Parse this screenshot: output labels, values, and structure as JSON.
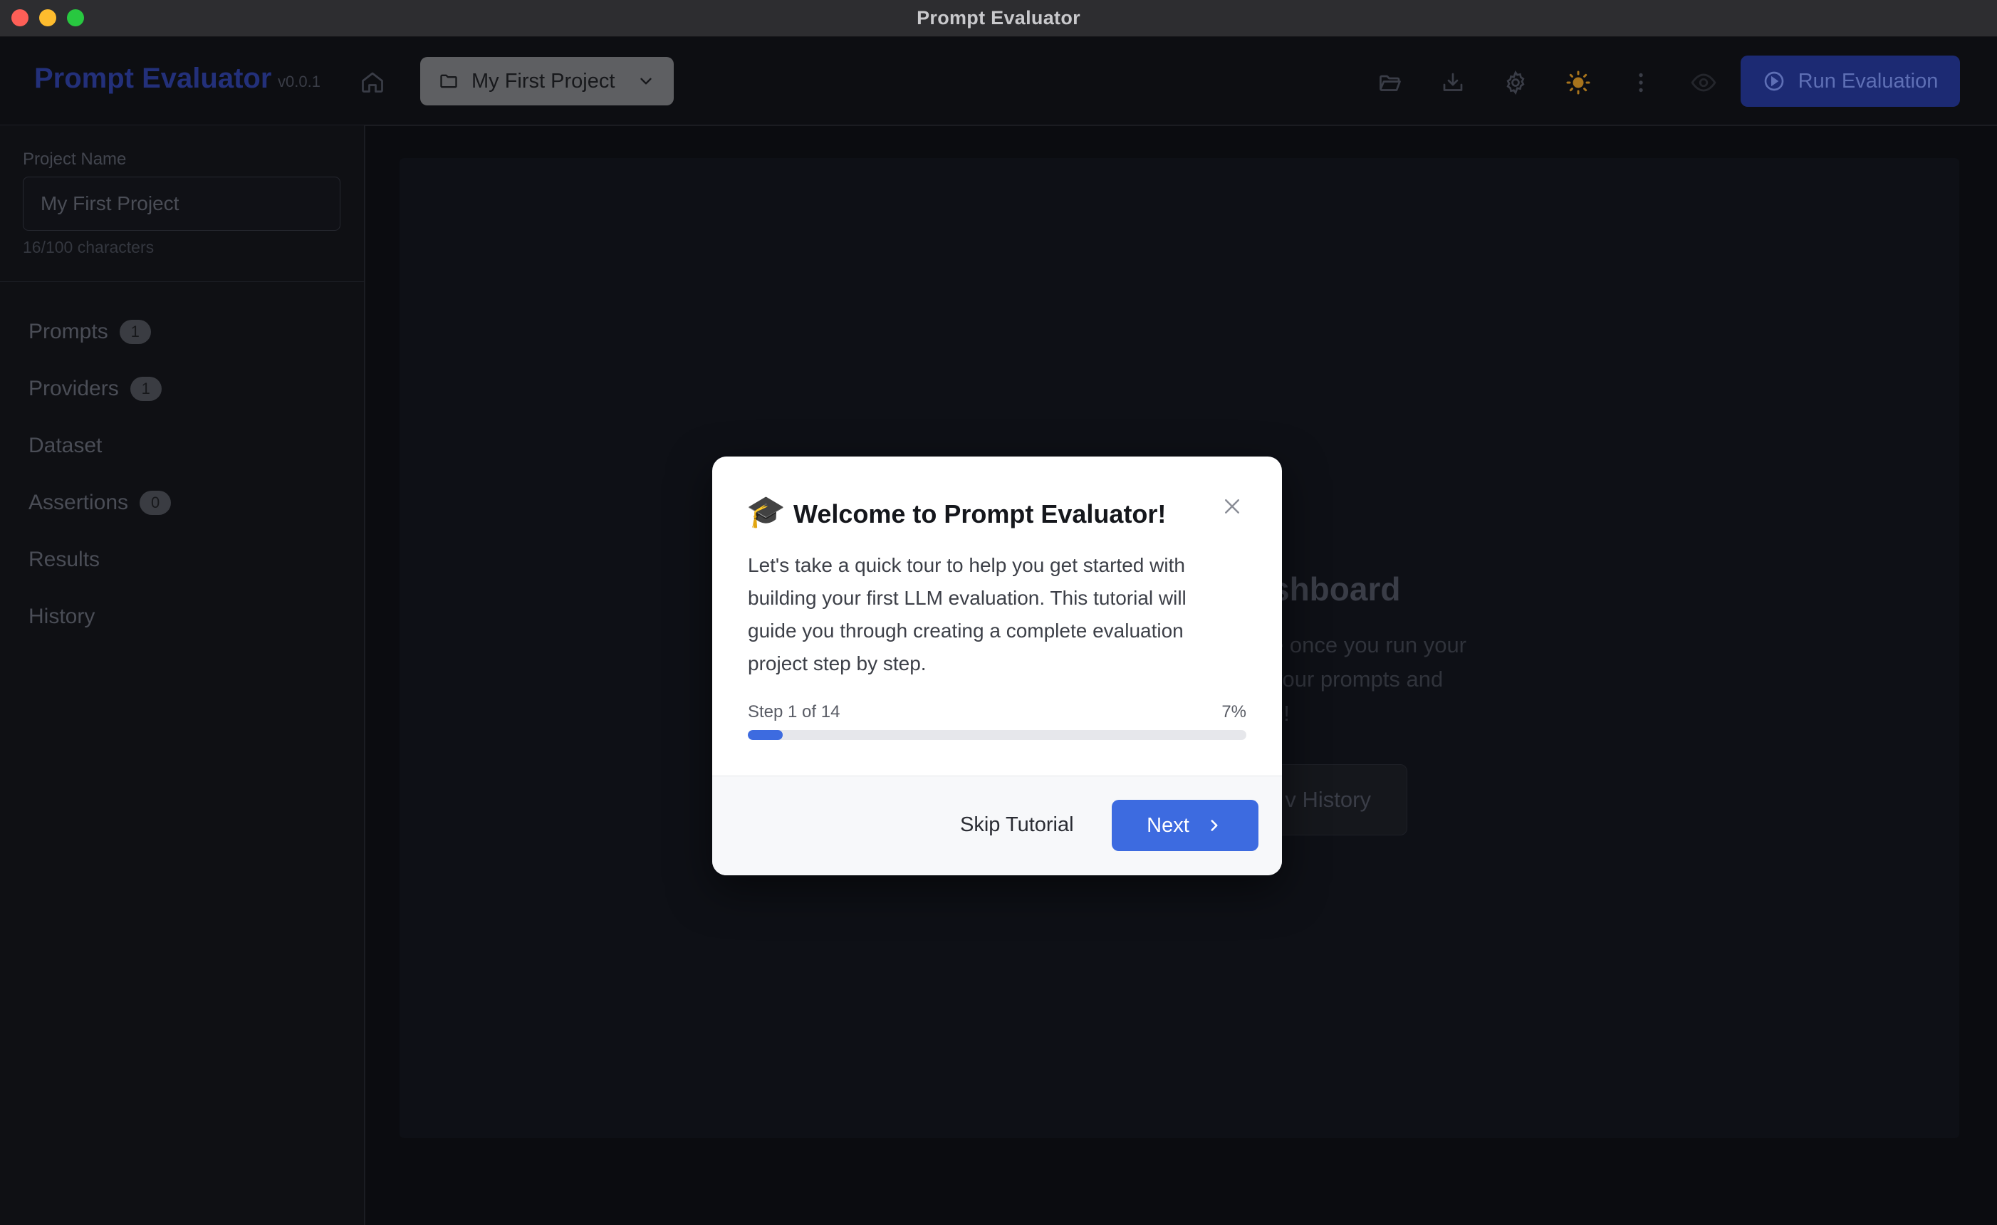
{
  "window": {
    "title": "Prompt Evaluator"
  },
  "header": {
    "brand": "Prompt Evaluator",
    "version": "v0.0.1",
    "project_selector": "My First Project",
    "run_label": "Run Evaluation"
  },
  "sidebar": {
    "project_name_label": "Project Name",
    "project_name_value": "My First Project",
    "char_count": "16/100 characters",
    "items": [
      {
        "label": "Prompts",
        "badge": "1"
      },
      {
        "label": "Providers",
        "badge": "1"
      },
      {
        "label": "Dataset"
      },
      {
        "label": "Assertions",
        "badge": "0"
      },
      {
        "label": "Results"
      },
      {
        "label": "History"
      }
    ]
  },
  "dashboard": {
    "title_fragment": "shboard",
    "desc_lines": [
      "e once you run your",
      "your prompts and",
      "n!"
    ],
    "button_fragment": "v History"
  },
  "modal": {
    "icon": "graduation-cap-icon",
    "title": "Welcome to Prompt Evaluator!",
    "body": "Let's take a quick tour to help you get started with building your first LLM evaluation. This tutorial will guide you through creating a complete evaluation project step by step.",
    "step_label": "Step 1 of 14",
    "percent_label": "7%",
    "progress": 0.07,
    "skip_label": "Skip Tutorial",
    "next_label": "Next"
  },
  "colors": {
    "accent": "#3d6be0",
    "brand": "#23307a",
    "run_button": "#1c2a73"
  }
}
